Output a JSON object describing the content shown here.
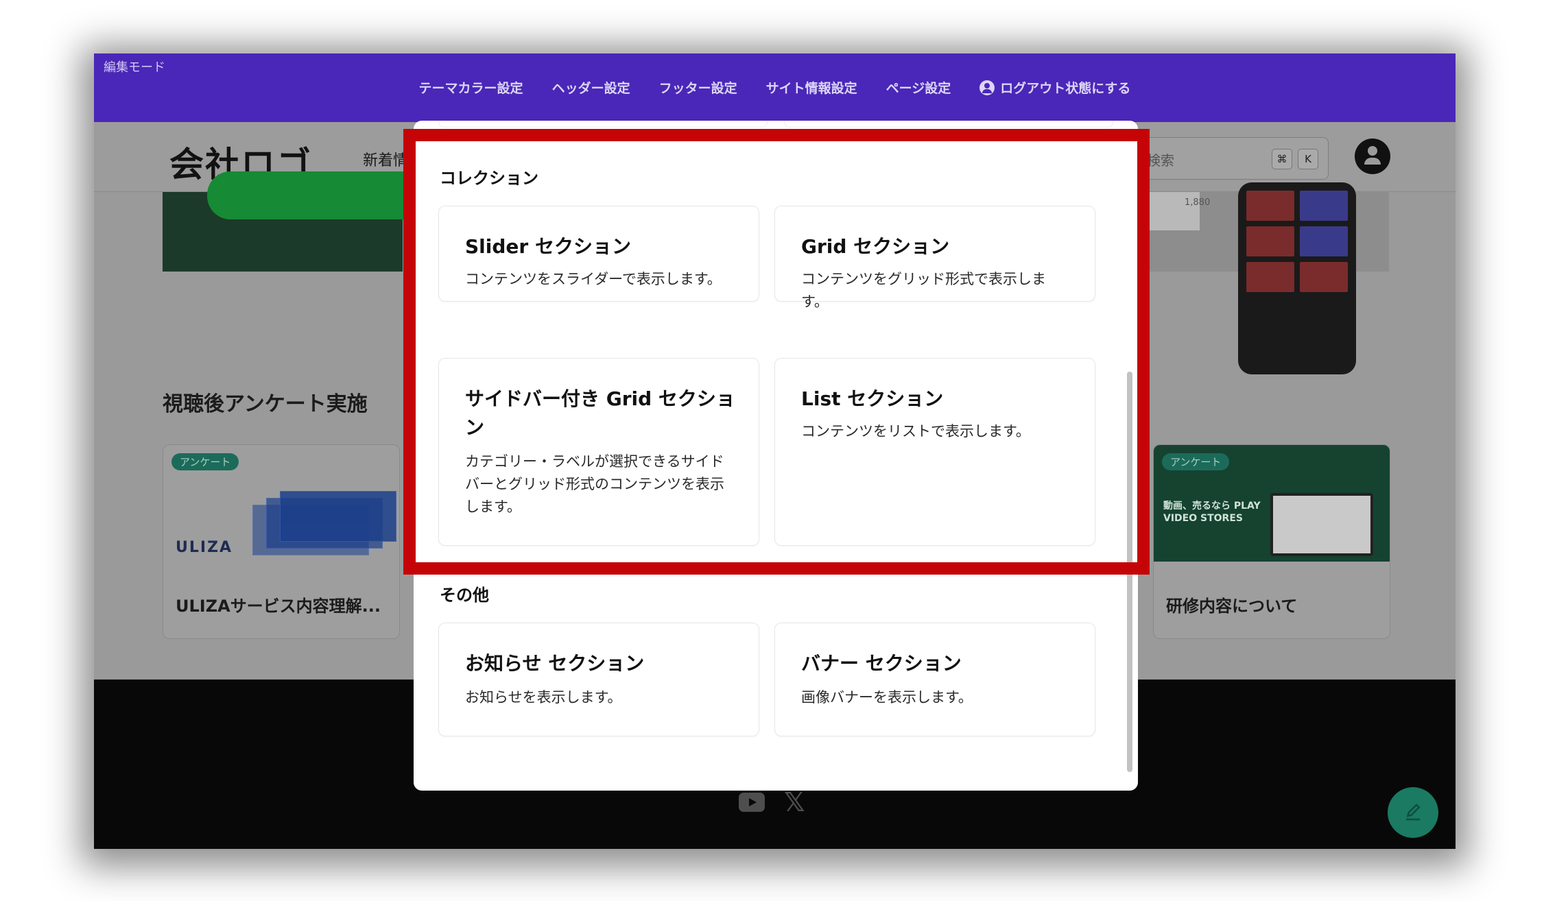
{
  "edit_bar": {
    "mode_label": "編集モード",
    "nav": [
      "テーマカラー設定",
      "ヘッダー設定",
      "フッター設定",
      "サイト情報設定",
      "ページ設定",
      "ログアウト状態にする"
    ]
  },
  "header": {
    "logo": "会社ロゴ",
    "nav_item": "新着情",
    "search_placeholder": "検索",
    "shortcut_keys": [
      "⌘",
      "K"
    ]
  },
  "page": {
    "price_text": "1,880",
    "section_heading": "視聴後アンケート実施",
    "cards": [
      {
        "tag": "アンケート",
        "brand": "ULIZA",
        "title": "ULIZAサービス内容理解..."
      },
      {
        "tag": "アンケート",
        "banner_text": "動画、売るなら PLAY VIDEO STORES",
        "title": "研修内容について"
      }
    ]
  },
  "modal": {
    "groups": [
      {
        "label": "コレクション",
        "options": [
          {
            "title": "Slider セクション",
            "desc": "コンテンツをスライダーで表示します。"
          },
          {
            "title": "Grid セクション",
            "desc": "コンテンツをグリッド形式で表示します。"
          },
          {
            "title": "サイドバー付き Grid セクション",
            "desc": "カテゴリー・ラベルが選択できるサイドバーとグリッド形式のコンテンツを表示します。"
          },
          {
            "title": "List セクション",
            "desc": "コンテンツをリストで表示します。"
          }
        ]
      },
      {
        "label": "その他",
        "options": [
          {
            "title": "お知らせ セクション",
            "desc": "お知らせを表示します。"
          },
          {
            "title": "バナー セクション",
            "desc": "画像バナーを表示します。"
          }
        ]
      }
    ]
  },
  "colors": {
    "edit_bar": "#4a27b8",
    "highlight": "#c50407",
    "fab": "#1a7a62"
  },
  "icons": [
    "user-circle-icon",
    "avatar-icon",
    "youtube-icon",
    "x-icon",
    "edit-pencil-icon"
  ]
}
